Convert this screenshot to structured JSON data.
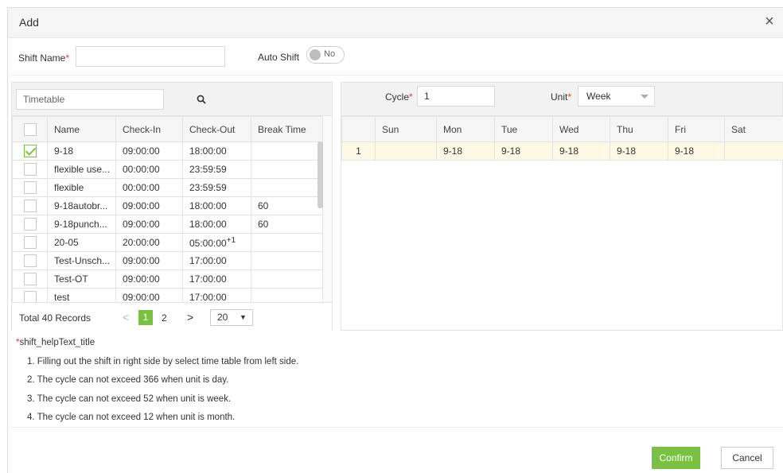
{
  "dialog": {
    "title": "Add",
    "close_glyph": "×"
  },
  "form": {
    "shift_name_label": "Shift Name",
    "required_mark": "*",
    "shift_name_value": "",
    "auto_shift_label": "Auto Shift",
    "auto_shift_state": "No"
  },
  "left": {
    "search_placeholder": "Timetable",
    "columns": [
      "Name",
      "Check-In",
      "Check-Out",
      "Break Time"
    ],
    "rows": [
      {
        "checked": true,
        "name": "9-18",
        "in": "09:00:00",
        "out": "18:00:00",
        "break": ""
      },
      {
        "checked": false,
        "name": "flexible use...",
        "in": "00:00:00",
        "out": "23:59:59",
        "break": ""
      },
      {
        "checked": false,
        "name": "flexible",
        "in": "00:00:00",
        "out": "23:59:59",
        "break": ""
      },
      {
        "checked": false,
        "name": "9-18autobr...",
        "in": "09:00:00",
        "out": "18:00:00",
        "break": "60"
      },
      {
        "checked": false,
        "name": "9-18punch...",
        "in": "09:00:00",
        "out": "18:00:00",
        "break": "60"
      },
      {
        "checked": false,
        "name": "20-05",
        "in": "20:00:00",
        "out": "05:00:00",
        "out_sup": "+1",
        "break": ""
      },
      {
        "checked": false,
        "name": "Test-Unsch...",
        "in": "09:00:00",
        "out": "17:00:00",
        "break": ""
      },
      {
        "checked": false,
        "name": "Test-OT",
        "in": "09:00:00",
        "out": "17:00:00",
        "break": ""
      },
      {
        "checked": false,
        "name": "test",
        "in": "09:00:00",
        "out": "17:00:00",
        "break": ""
      }
    ],
    "pager": {
      "total": "Total 40 Records",
      "prev": "<",
      "pages": [
        "1",
        "2"
      ],
      "next": ">",
      "page_size": "20"
    }
  },
  "right": {
    "cycle_label": "Cycle",
    "cycle_value": "1",
    "unit_label": "Unit",
    "unit_value": "Week",
    "days": [
      "Sun",
      "Mon",
      "Tue",
      "Wed",
      "Thu",
      "Fri",
      "Sat"
    ],
    "schedule": [
      {
        "index": "1",
        "cells": [
          "",
          "9-18",
          "9-18",
          "9-18",
          "9-18",
          "9-18",
          ""
        ]
      }
    ]
  },
  "help": {
    "title": "shift_helpText_title",
    "lines": [
      "1. Filling out the shift in right side by select time table from left side.",
      "2. The cycle can not exceed 366 when unit is day.",
      "3. The cycle can not exceed 52 when unit is week.",
      "4. The cycle can not exceed 12 when unit is month."
    ]
  },
  "buttons": {
    "confirm": "Confirm",
    "cancel": "Cancel"
  },
  "colors": {
    "accent": "#7ac143",
    "required": "#e53935",
    "row_highlight": "#fdf9e5"
  }
}
